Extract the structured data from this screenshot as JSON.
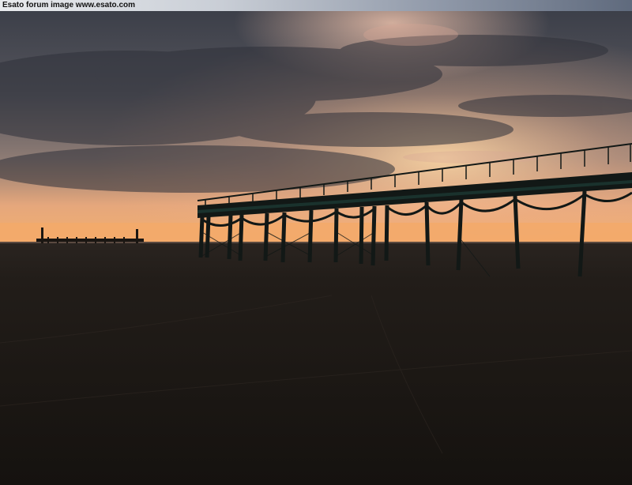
{
  "watermark": {
    "text": "Esato forum image www.esato.com"
  },
  "photo": {
    "subject": "pier-at-sunset",
    "colors": {
      "sky_top": "#3a3d47",
      "sky_glow": "#f2b57a",
      "horizon": "#f7b070",
      "sand": "#1e1a16",
      "pier": "#141a18"
    }
  }
}
